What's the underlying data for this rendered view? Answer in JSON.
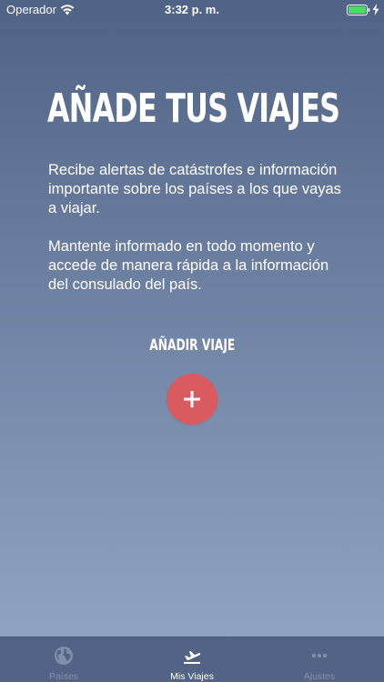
{
  "status_bar": {
    "carrier": "Operador",
    "time": "3:32 p. m.",
    "wifi_icon": "wifi-icon",
    "battery_icon": "battery-icon",
    "charging_icon": "charging-bolt-icon",
    "battery_color": "#4cd964"
  },
  "main": {
    "title": "AÑADE TUS VIAJES",
    "paragraph_1": "Recibe alertas de catástrofes e información importante sobre los países a los que vayas a viajar.",
    "paragraph_2": "Mantente informado en todo momento y accede de manera rápida a la información del consulado del país.",
    "add_label": "AÑADIR VIAJE",
    "add_button_icon": "plus-icon",
    "accent_color": "#d95a5f"
  },
  "tab_bar": {
    "active": "Mis Viajes",
    "tabs": [
      {
        "label": "Países",
        "icon": "globe-icon"
      },
      {
        "label": "Mis Viajes",
        "icon": "airplane-icon"
      },
      {
        "label": "Ajustes",
        "icon": "ellipsis-icon"
      }
    ]
  }
}
